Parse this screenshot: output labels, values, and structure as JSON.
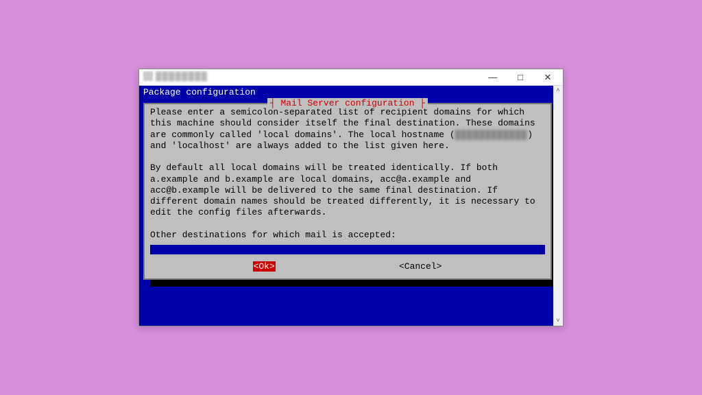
{
  "window": {
    "minimize": "—",
    "maximize": "□",
    "close": "✕"
  },
  "header": "Package configuration",
  "dialog": {
    "title": "┤ Mail Server configuration ├",
    "para1_a": "Please enter a semicolon-separated list of recipient domains for which\nthis machine should consider itself the final destination. These domains\nare commonly called 'local domains'. The local hostname (",
    "hostname_redacted": "████████████",
    "para1_b": ")\nand 'localhost' are always added to the list given here.",
    "para2": "By default all local domains will be treated identically. If both\na.example and b.example are local domains, acc@a.example and\nacc@b.example will be delivered to the same final destination. If\ndifferent domain names should be treated differently, it is necessary to\nedit the config files afterwards.",
    "prompt": "Other destinations for which mail is accepted:",
    "input_value": "",
    "ok": "<Ok>",
    "cancel": "<Cancel>"
  }
}
